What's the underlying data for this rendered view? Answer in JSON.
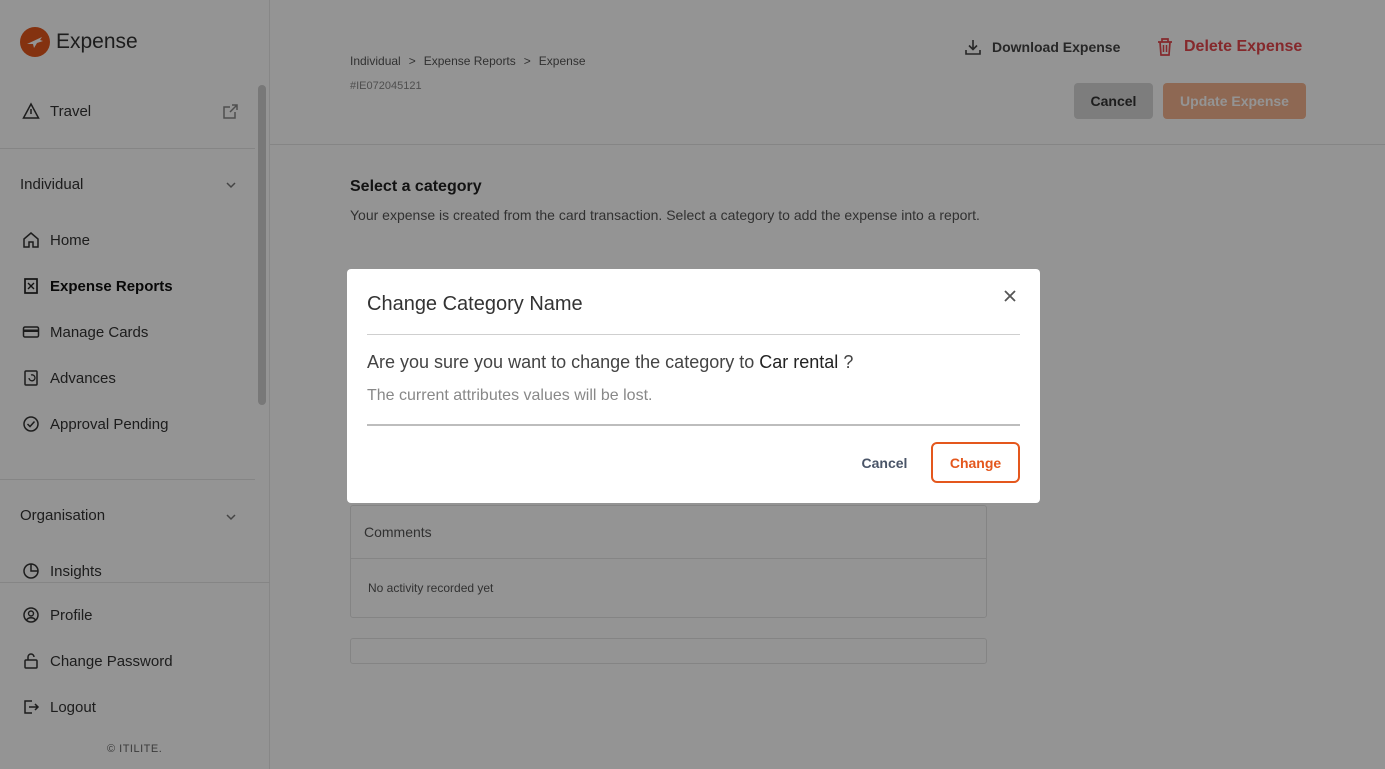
{
  "app": {
    "title": "Expense"
  },
  "sidebar": {
    "travel_label": "Travel",
    "individual": {
      "title": "Individual",
      "items": [
        {
          "label": "Home"
        },
        {
          "label": "Expense Reports"
        },
        {
          "label": "Manage Cards"
        },
        {
          "label": "Advances"
        },
        {
          "label": "Approval Pending"
        }
      ]
    },
    "organisation": {
      "title": "Organisation",
      "items": [
        {
          "label": "Insights"
        }
      ]
    },
    "account": [
      {
        "label": "Profile"
      },
      {
        "label": "Change Password"
      },
      {
        "label": "Logout"
      }
    ],
    "copyright": "© ITILITE."
  },
  "header": {
    "breadcrumb": [
      "Individual",
      ">",
      "Expense Reports",
      ">",
      "Expense"
    ],
    "expense_id": "#IE072045121",
    "download_label": "Download Expense",
    "delete_label": "Delete Expense",
    "cancel_label": "Cancel",
    "update_label": "Update Expense"
  },
  "category": {
    "title": "Select a category",
    "description": "Your expense is created from the card transaction. Select a category to add the expense into a report."
  },
  "comments": {
    "title": "Comments",
    "empty": "No activity recorded yet"
  },
  "modal": {
    "title": "Change Category Name",
    "question_prefix": "Are you sure you want to change the category to",
    "category_name": "Car rental",
    "question_suffix": "?",
    "subtext": "The current attributes values will be lost.",
    "cancel_label": "Cancel",
    "change_label": "Change"
  },
  "colors": {
    "accent": "#e4571d",
    "danger": "#e5484d",
    "overlay": "rgba(0,0,0,0.42)"
  }
}
